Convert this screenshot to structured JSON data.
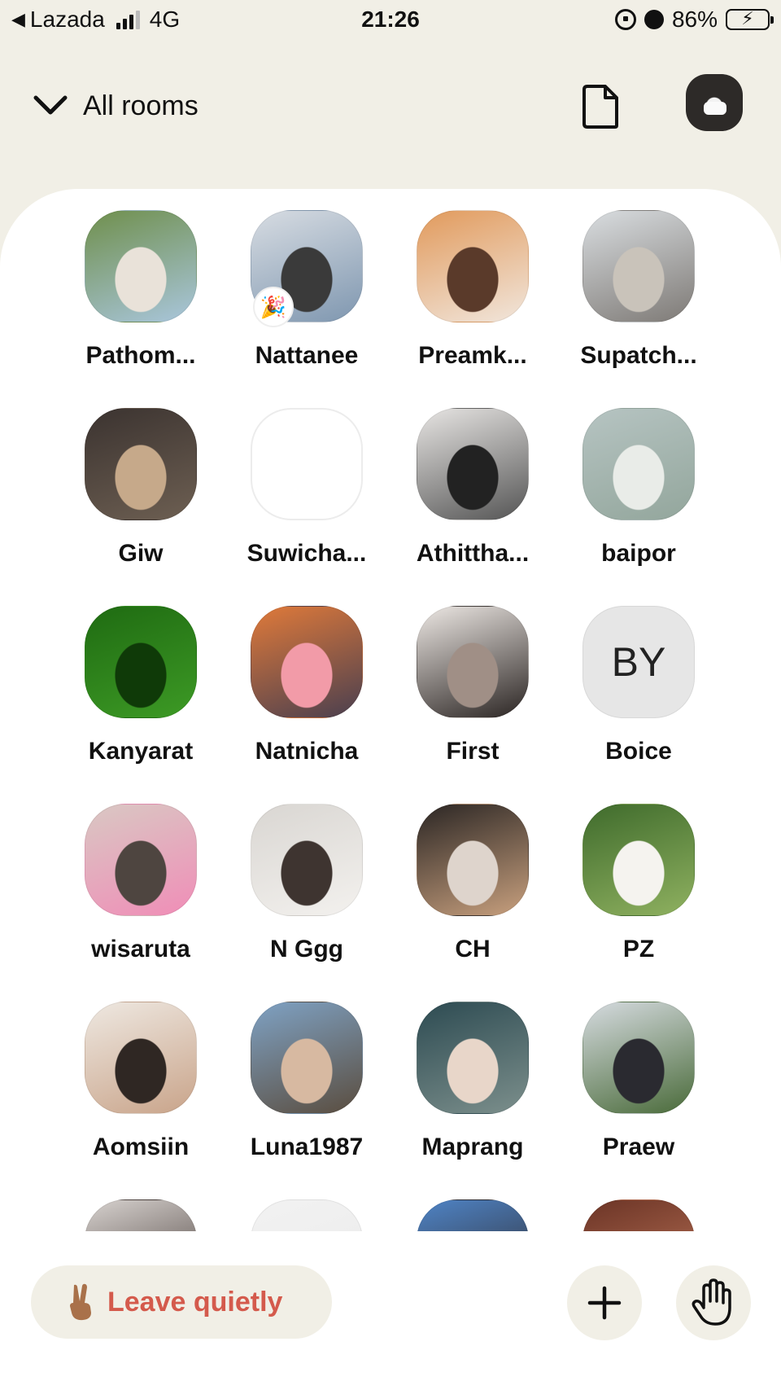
{
  "status_bar": {
    "back_app": "Lazada",
    "network": "4G",
    "time": "21:26",
    "battery": "86%",
    "battery_level": 0.86,
    "icons": [
      "signal-icon",
      "rotation-lock-icon",
      "alarm-icon",
      "battery-charging-icon"
    ]
  },
  "header": {
    "rooms_label": "All rooms",
    "doc_icon": "document-icon",
    "profile": "profile-avatar"
  },
  "people": [
    {
      "name": "Pathom...",
      "avatar": "photo",
      "colors": [
        "#6f8f4c",
        "#a9c6dc",
        "#e9e2d9"
      ],
      "badge": ""
    },
    {
      "name": "Nattanee",
      "avatar": "photo",
      "colors": [
        "#d7dce2",
        "#7f97b0",
        "#3a3a3a"
      ],
      "badge": "🎉"
    },
    {
      "name": "Preamk...",
      "avatar": "photo",
      "colors": [
        "#e19a5c",
        "#f1e6dc",
        "#5a3a2a"
      ],
      "badge": ""
    },
    {
      "name": "Supatch...",
      "avatar": "photo",
      "colors": [
        "#d9dde0",
        "#7e7a76",
        "#c9c3ba"
      ],
      "badge": ""
    },
    {
      "name": "Giw",
      "avatar": "photo",
      "colors": [
        "#3b3330",
        "#6d5f52",
        "#c6a98a"
      ],
      "badge": ""
    },
    {
      "name": "Suwicha...",
      "avatar": "blank",
      "colors": [
        "#ffffff",
        "#ffffff",
        "#ffffff"
      ],
      "badge": ""
    },
    {
      "name": "Athittha...",
      "avatar": "photo",
      "colors": [
        "#e7e5e3",
        "#555555",
        "#222222"
      ],
      "badge": ""
    },
    {
      "name": "baipor",
      "avatar": "photo",
      "colors": [
        "#b6c4c2",
        "#93a69c",
        "#e9ece8"
      ],
      "badge": ""
    },
    {
      "name": "Kanyarat",
      "avatar": "photo",
      "colors": [
        "#1f6b12",
        "#3d9a25",
        "#0f3a08"
      ],
      "badge": ""
    },
    {
      "name": "Natnicha",
      "avatar": "photo",
      "colors": [
        "#e07a3a",
        "#4a3f4f",
        "#f29ba8"
      ],
      "badge": ""
    },
    {
      "name": "First",
      "avatar": "photo",
      "colors": [
        "#ede8e4",
        "#2b2523",
        "#a08f86"
      ],
      "badge": ""
    },
    {
      "name": "Boice",
      "avatar": "initials",
      "initials": "BY",
      "colors": [
        "#e6e6e6",
        "#e6e6e6",
        "#e6e6e6"
      ],
      "badge": ""
    },
    {
      "name": "wisaruta",
      "avatar": "photo",
      "colors": [
        "#d9c8c3",
        "#f08db7",
        "#4e4540"
      ],
      "badge": ""
    },
    {
      "name": "N Ggg",
      "avatar": "photo",
      "colors": [
        "#d9d6d2",
        "#f3f1ee",
        "#3e3430"
      ],
      "badge": ""
    },
    {
      "name": "CH",
      "avatar": "photo",
      "colors": [
        "#2b2624",
        "#c8a07e",
        "#ded4cc"
      ],
      "badge": ""
    },
    {
      "name": "PZ",
      "avatar": "photo",
      "colors": [
        "#3f6b2c",
        "#8fb160",
        "#f5f3ef"
      ],
      "badge": ""
    },
    {
      "name": "Aomsiin",
      "avatar": "photo",
      "colors": [
        "#eee8e1",
        "#c9a48a",
        "#2f2723"
      ],
      "badge": ""
    },
    {
      "name": "Luna1987",
      "avatar": "photo",
      "colors": [
        "#7fa2c4",
        "#5a4d3f",
        "#d7b9a1"
      ],
      "badge": ""
    },
    {
      "name": "Maprang",
      "avatar": "photo",
      "colors": [
        "#2d4b52",
        "#7c8f8c",
        "#e8d6c9"
      ],
      "badge": ""
    },
    {
      "name": "Praew",
      "avatar": "photo",
      "colors": [
        "#d6dbe0",
        "#4a6b3a",
        "#2a2a30"
      ],
      "badge": ""
    },
    {
      "name": "",
      "avatar": "photo",
      "colors": [
        "#d7d2cf",
        "#3a2e2a",
        "#f0eeec"
      ],
      "badge": ""
    },
    {
      "name": "",
      "avatar": "photo",
      "colors": [
        "#f2f2f2",
        "#eaeaea",
        "#333333"
      ],
      "badge": ""
    },
    {
      "name": "",
      "avatar": "photo",
      "colors": [
        "#4f84c6",
        "#2b2220",
        "#d9b8a6"
      ],
      "badge": ""
    },
    {
      "name": "",
      "avatar": "photo",
      "colors": [
        "#6b3426",
        "#c47a5c",
        "#3a1c14"
      ],
      "badge": ""
    }
  ],
  "bottom_bar": {
    "leave_label": "Leave quietly",
    "leave_icon": "victory-hand-icon",
    "add_icon": "plus-icon",
    "raise_hand_icon": "raise-hand-icon",
    "leave_color": "#d45a4c",
    "button_bg": "#f1efe6"
  }
}
